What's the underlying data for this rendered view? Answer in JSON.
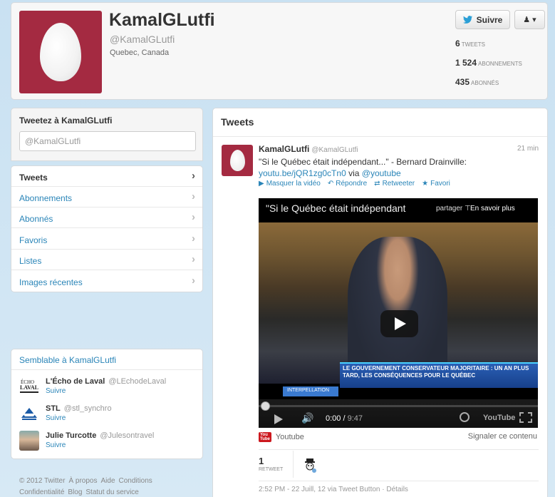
{
  "profile": {
    "name": "KamalGLutfi",
    "handle": "@KamalGLutfi",
    "location": "Quebec, Canada",
    "follow_label": "Suivre",
    "stats": [
      {
        "value": "6",
        "label": "TWEETS"
      },
      {
        "value": "1 524",
        "label": "ABONNEMENTS"
      },
      {
        "value": "435",
        "label": "ABONNÉS"
      }
    ]
  },
  "compose": {
    "title": "Tweetez à KamalGLutfi",
    "value": "@KamalGLutfi"
  },
  "nav": {
    "items": [
      {
        "label": "Tweets"
      },
      {
        "label": "Abonnements"
      },
      {
        "label": "Abonnés"
      },
      {
        "label": "Favoris"
      },
      {
        "label": "Listes"
      },
      {
        "label": "Images récentes"
      }
    ]
  },
  "similar": {
    "title": "Semblable à KamalGLutfi",
    "follow_label": "Suivre",
    "accounts": [
      {
        "name": "L'Écho de Laval",
        "handle": "@LEchodeLaval"
      },
      {
        "name": "STL",
        "handle": "@stl_synchro"
      },
      {
        "name": "Julie Turcotte",
        "handle": "@Julesontravel"
      }
    ]
  },
  "footer": {
    "links": [
      "© 2012 Twitter",
      "À propos",
      "Aide",
      "Conditions",
      "Confidentialité",
      "Blog",
      "Statut du service"
    ]
  },
  "timeline": {
    "title": "Tweets",
    "tweet": {
      "name": "KamalGLutfi",
      "handle": "@KamalGLutfi",
      "time": "21 min",
      "text_main": "\"Si le Québec était indépendant...\" - Bernard Drainville:",
      "link": "youtu.be/jQR1zg0cTn0",
      "via": "via",
      "mention": "@youtube",
      "actions": {
        "hide_video": "Masquer la vidéo",
        "reply": "Répondre",
        "retweet": "Retweeter",
        "favorite": "Favori"
      },
      "video": {
        "title": "\"Si le Québec était indépendant",
        "share": "partager",
        "more": "En savoir plus",
        "lower_third": "LE GOUVERNEMENT CONSERVATEUR MAJORITAIRE : UN AN PLUS TARD, LES CONSÉQUENCES POUR LE QUÉBEC",
        "badge": "INTERPELLATION",
        "current_time": "0:00",
        "duration": "9:47",
        "yt": "YouTube",
        "progress": 0
      },
      "source": "Youtube",
      "report": "Signaler ce contenu",
      "retweet_count": "1",
      "retweet_label": "RETWEET",
      "meta": "2:52 PM - 22 Juill, 12 via Tweet Button · Détails"
    }
  },
  "colors": {
    "accent": "#2a85b8",
    "avatar_bg": "#a42a41"
  }
}
